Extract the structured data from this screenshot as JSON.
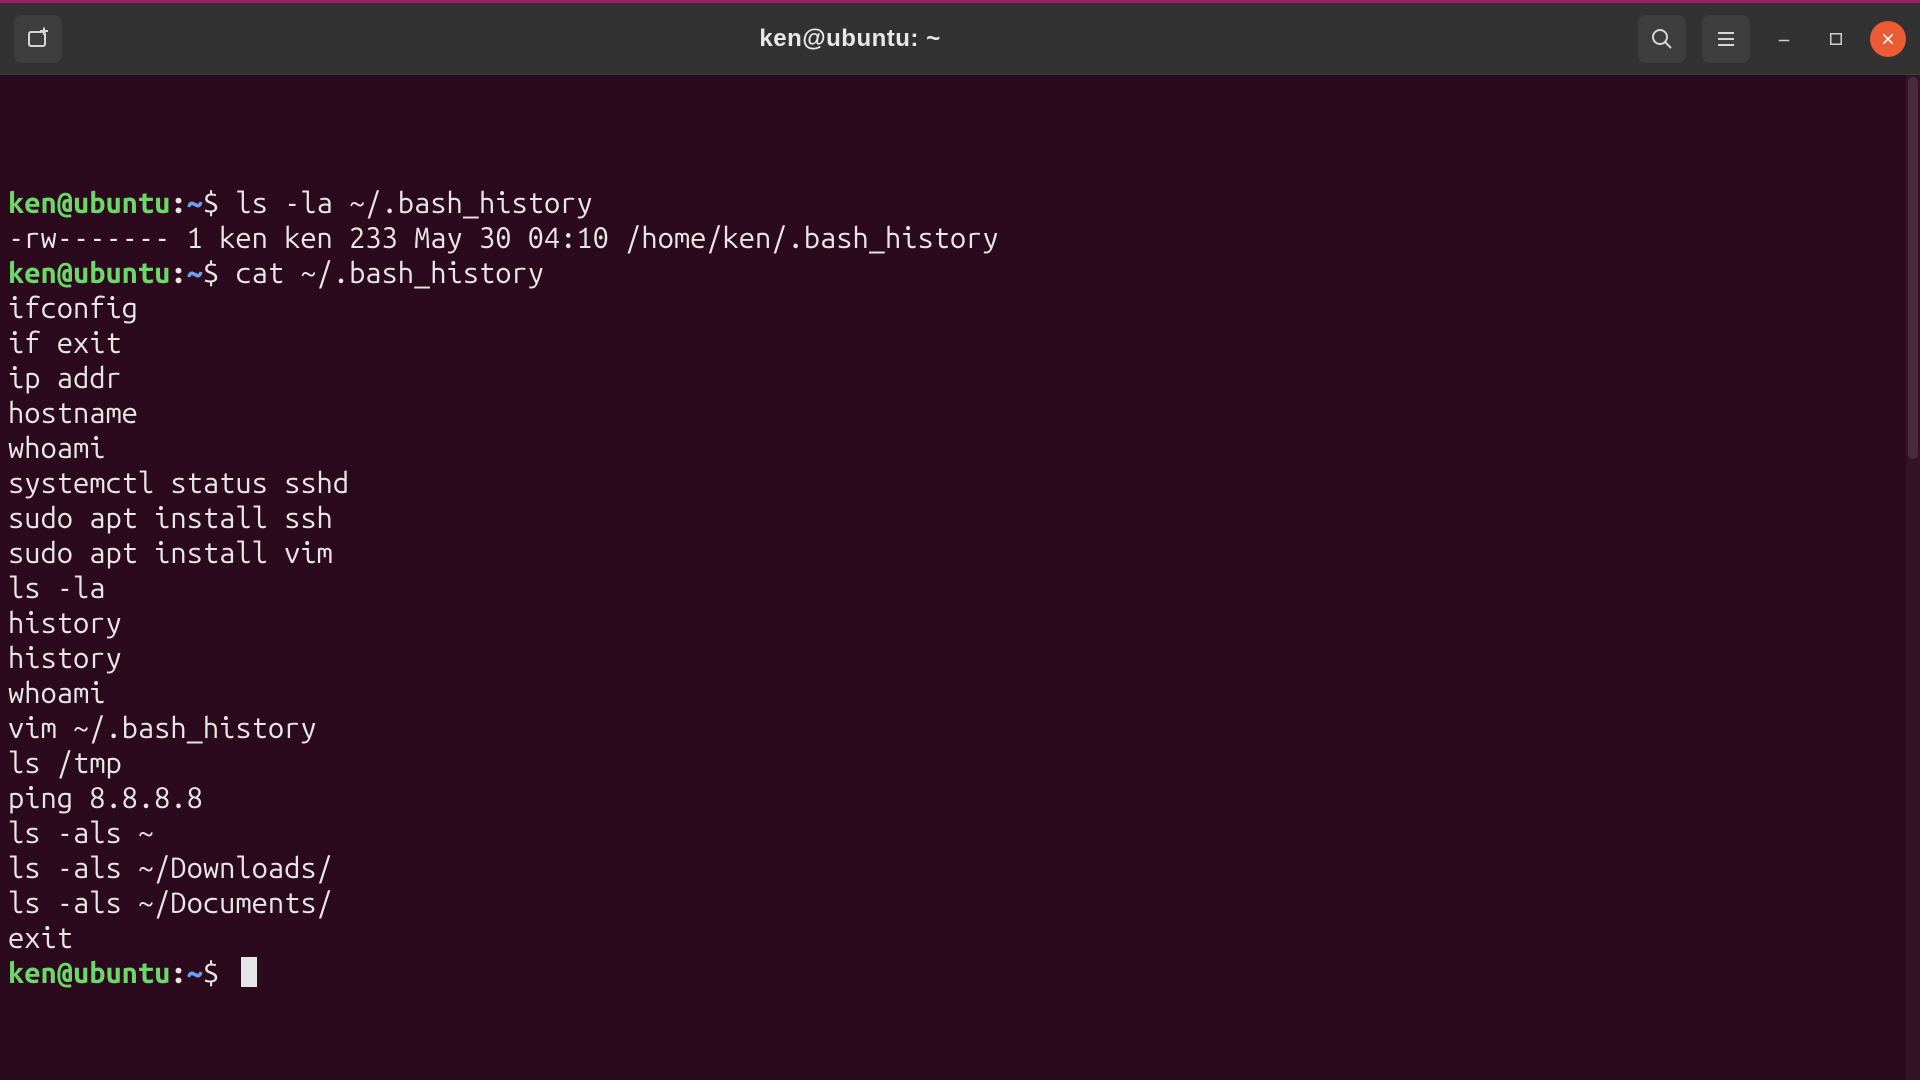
{
  "titlebar": {
    "title": "ken@ubuntu: ~"
  },
  "prompt": {
    "user_host": "ken@ubuntu",
    "sep": ":",
    "path": "~",
    "sigil": "$"
  },
  "lines": [
    {
      "type": "prompt",
      "cmd": "ls -la ~/.bash_history"
    },
    {
      "type": "out",
      "text": "-rw------- 1 ken ken 233 May 30 04:10 /home/ken/.bash_history"
    },
    {
      "type": "prompt",
      "cmd": "cat ~/.bash_history"
    },
    {
      "type": "out",
      "text": "ifconfig"
    },
    {
      "type": "out",
      "text": "if exit"
    },
    {
      "type": "out",
      "text": "ip addr"
    },
    {
      "type": "out",
      "text": "hostname"
    },
    {
      "type": "out",
      "text": "whoami"
    },
    {
      "type": "out",
      "text": "systemctl status sshd"
    },
    {
      "type": "out",
      "text": "sudo apt install ssh"
    },
    {
      "type": "out",
      "text": "sudo apt install vim"
    },
    {
      "type": "out",
      "text": "ls -la"
    },
    {
      "type": "out",
      "text": "history"
    },
    {
      "type": "out",
      "text": "history"
    },
    {
      "type": "out",
      "text": "whoami"
    },
    {
      "type": "out",
      "text": "vim ~/.bash_history"
    },
    {
      "type": "out",
      "text": "ls /tmp"
    },
    {
      "type": "out",
      "text": "ping 8.8.8.8"
    },
    {
      "type": "out",
      "text": "ls -als ~"
    },
    {
      "type": "out",
      "text": "ls -als ~/Downloads/"
    },
    {
      "type": "out",
      "text": "ls -als ~/Documents/"
    },
    {
      "type": "out",
      "text": "exit"
    },
    {
      "type": "prompt",
      "cmd": "",
      "cursor": true
    }
  ]
}
